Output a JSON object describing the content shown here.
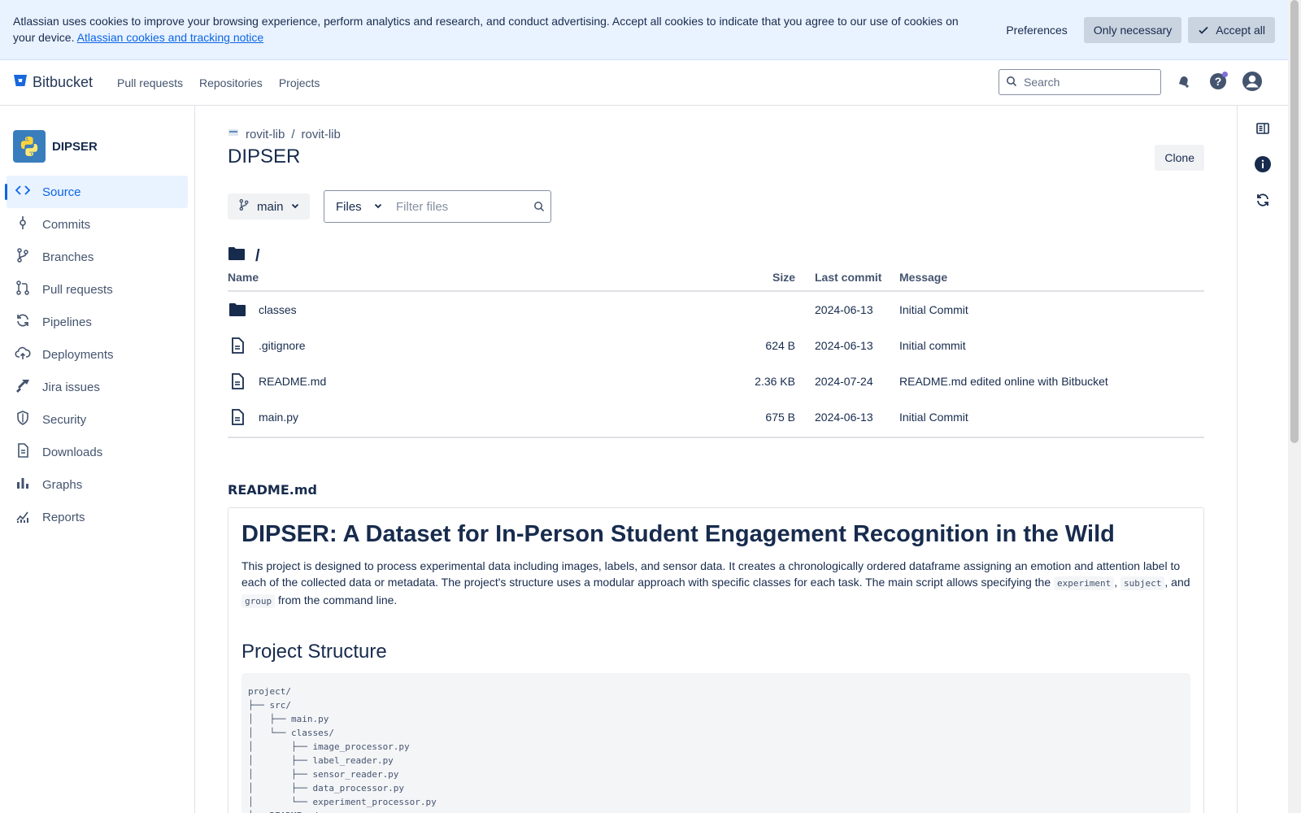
{
  "cookie": {
    "text": "Atlassian uses cookies to improve your browsing experience, perform analytics and research, and conduct advertising. Accept all cookies to indicate that you agree to our use of cookies on your device.",
    "link": "Atlassian cookies and tracking notice",
    "preferences": "Preferences",
    "only_necessary": "Only necessary",
    "accept_all": "Accept all"
  },
  "topnav": {
    "brand": "Bitbucket",
    "links": [
      "Pull requests",
      "Repositories",
      "Projects"
    ],
    "search_placeholder": "Search"
  },
  "sidebar": {
    "repo_name": "DIPSER",
    "items": [
      {
        "label": "Source",
        "icon": "code-icon",
        "active": true
      },
      {
        "label": "Commits",
        "icon": "commit-icon"
      },
      {
        "label": "Branches",
        "icon": "branch-icon"
      },
      {
        "label": "Pull requests",
        "icon": "pull-request-icon"
      },
      {
        "label": "Pipelines",
        "icon": "pipelines-icon"
      },
      {
        "label": "Deployments",
        "icon": "cloud-upload-icon"
      },
      {
        "label": "Jira issues",
        "icon": "jira-icon"
      },
      {
        "label": "Security",
        "icon": "shield-icon"
      },
      {
        "label": "Downloads",
        "icon": "document-icon"
      },
      {
        "label": "Graphs",
        "icon": "bar-chart-icon"
      },
      {
        "label": "Reports",
        "icon": "line-chart-icon"
      }
    ]
  },
  "main": {
    "breadcrumb": [
      "rovit-lib",
      "rovit-lib"
    ],
    "title": "DIPSER",
    "clone": "Clone",
    "branch": "main",
    "filter_mode": "Files",
    "filter_placeholder": "Filter files",
    "path": "/",
    "columns": {
      "name": "Name",
      "size": "Size",
      "last_commit": "Last commit",
      "message": "Message"
    },
    "files": [
      {
        "name": "classes",
        "type": "folder",
        "size": "",
        "date": "2024-06-13",
        "message": "Initial Commit"
      },
      {
        "name": ".gitignore",
        "type": "file",
        "size": "624 B",
        "date": "2024-06-13",
        "message": "Initial commit"
      },
      {
        "name": "README.md",
        "type": "file",
        "size": "2.36 KB",
        "date": "2024-07-24",
        "message": "README.md edited online with Bitbucket"
      },
      {
        "name": "main.py",
        "type": "file",
        "size": "675 B",
        "date": "2024-06-13",
        "message": "Initial Commit"
      }
    ]
  },
  "readme": {
    "label": "README.md",
    "h1": "DIPSER: A Dataset for In-Person Student Engagement Recognition in the Wild",
    "p_start": "This project is designed to process experimental data including images, labels, and sensor data. It creates a chronologically ordered dataframe assigning an emotion and attention label to each of the collected data or metadata. The project's structure uses a modular approach with specific classes for each task. The main script allows specifying the ",
    "code1": "experiment",
    "sep1": ", ",
    "code2": "subject",
    "sep2": ", and ",
    "code3": "group",
    "p_end": " from the command line.",
    "h2": "Project Structure",
    "tree": "project/\n├── src/\n│   ├── main.py\n│   └── classes/\n│       ├── image_processor.py\n│       ├── label_reader.py\n│       ├── sensor_reader.py\n│       ├── data_processor.py\n│       └── experiment_processor.py\n└── README.md"
  }
}
